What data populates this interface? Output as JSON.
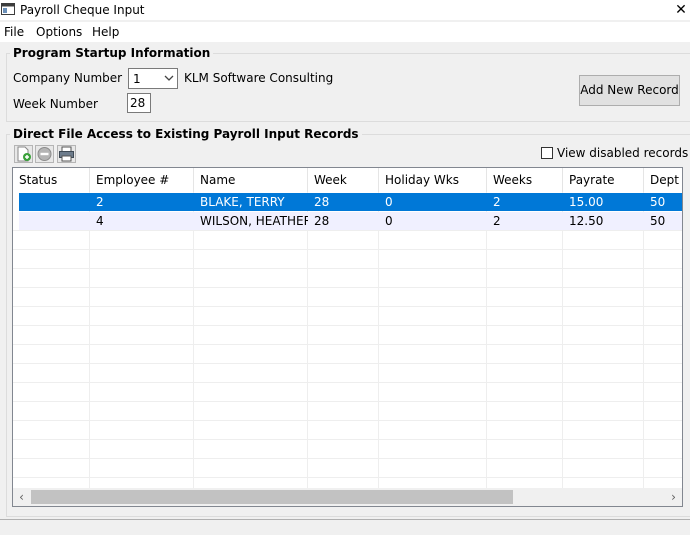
{
  "window": {
    "title": "Payroll Cheque Input"
  },
  "menu": {
    "items": [
      "File",
      "Options",
      "Help"
    ]
  },
  "startup": {
    "legend": "Program Startup Information",
    "company_label": "Company Number",
    "company_value": "1",
    "company_name": "KLM Software  Consulting",
    "week_label": "Week Number",
    "week_value": "28",
    "add_button": "Add New Record"
  },
  "access": {
    "legend": "Direct File Access to Existing Payroll Input Records",
    "view_disabled_label": "View disabled records",
    "view_disabled_checked": false
  },
  "table": {
    "columns": [
      "Status",
      "Employee #",
      "Name",
      "Week",
      "Holiday Wks",
      "Weeks",
      "Payrate",
      "Dept"
    ],
    "rows": [
      {
        "status": "",
        "employee": "2",
        "name": "BLAKE, TERRY",
        "week": "28",
        "holiday": "0",
        "weeks": "2",
        "payrate": "15.00",
        "dept": "50",
        "selected": true
      },
      {
        "status": "",
        "employee": "4",
        "name": "WILSON, HEATHER",
        "week": "28",
        "holiday": "0",
        "weeks": "2",
        "payrate": "12.50",
        "dept": "50",
        "selected": false
      }
    ]
  },
  "icons": [
    "app-window-icon",
    "close-icon",
    "chevron-down-icon",
    "new-record-icon",
    "disable-record-icon",
    "print-icon",
    "scroll-left-icon",
    "scroll-right-icon"
  ],
  "colors": {
    "selection": "#0078d7",
    "selection_text": "#ffffff"
  }
}
